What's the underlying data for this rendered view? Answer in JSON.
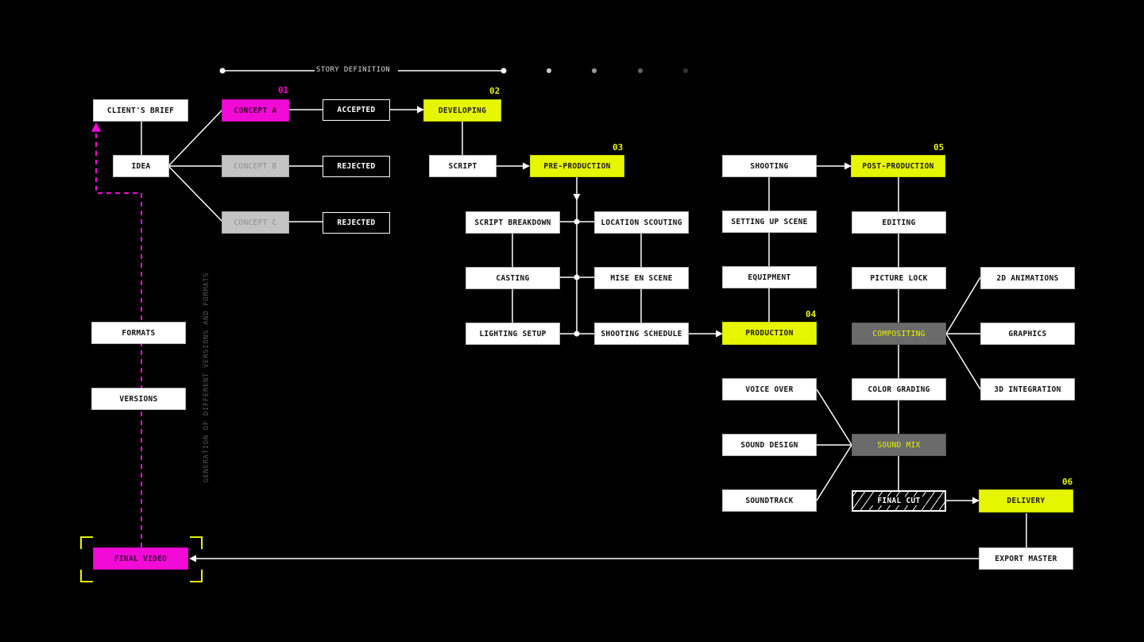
{
  "colors": {
    "background": "#000000",
    "accent_yellow": "#e6f500",
    "accent_magenta": "#f20ad6",
    "node_white": "#ffffff",
    "node_grey": "#c4c4c4",
    "node_dark": "#6b6b6b",
    "wire": "#ffffff"
  },
  "timeline": {
    "label": "STORY DEFINITION",
    "steps": 6,
    "active_step": 1
  },
  "stage_numbers": {
    "s01": "01",
    "s02": "02",
    "s03": "03",
    "s04": "04",
    "s05": "05",
    "s06": "06"
  },
  "side_note": "GENERATION OF DIFFERENT VERSIONS AND FORMATS",
  "nodes": {
    "clients_brief": "CLIENT'S BRIEF",
    "idea": "IDEA",
    "concept_a": "CONCEPT A",
    "concept_b": "CONCEPT B",
    "concept_c": "CONCEPT C",
    "accepted": "ACCEPTED",
    "rejected_b": "REJECTED",
    "rejected_c": "REJECTED",
    "developing": "DEVELOPING",
    "script": "SCRIPT",
    "pre_production": "PRE-PRODUCTION",
    "script_breakdown": "SCRIPT BREAKDOWN",
    "casting": "CASTING",
    "lighting_setup": "LIGHTING SETUP",
    "location_scouting": "LOCATION SCOUTING",
    "mise_en_scene": "MISE EN SCENE",
    "shooting_schedule": "SHOOTING SCHEDULE",
    "shooting": "SHOOTING",
    "setting_up_scene": "SETTING UP SCENE",
    "equipment": "EQUIPMENT",
    "production": "PRODUCTION",
    "voice_over": "VOICE OVER",
    "sound_design": "SOUND DESIGN",
    "soundtrack": "SOUNDTRACK",
    "post_production": "POST-PRODUCTION",
    "editing": "EDITING",
    "picture_lock": "PICTURE LOCK",
    "compositing": "COMPOSITING",
    "color_grading": "COLOR GRADING",
    "sound_mix": "SOUND MIX",
    "final_cut": "FINAL CUT",
    "animations_2d": "2D ANIMATIONS",
    "graphics": "GRAPHICS",
    "integration_3d": "3D INTEGRATION",
    "delivery": "DELIVERY",
    "export_master": "EXPORT MASTER",
    "formats": "FORMATS",
    "versions": "VERSIONS",
    "final_video": "FINAL VIDEO"
  }
}
